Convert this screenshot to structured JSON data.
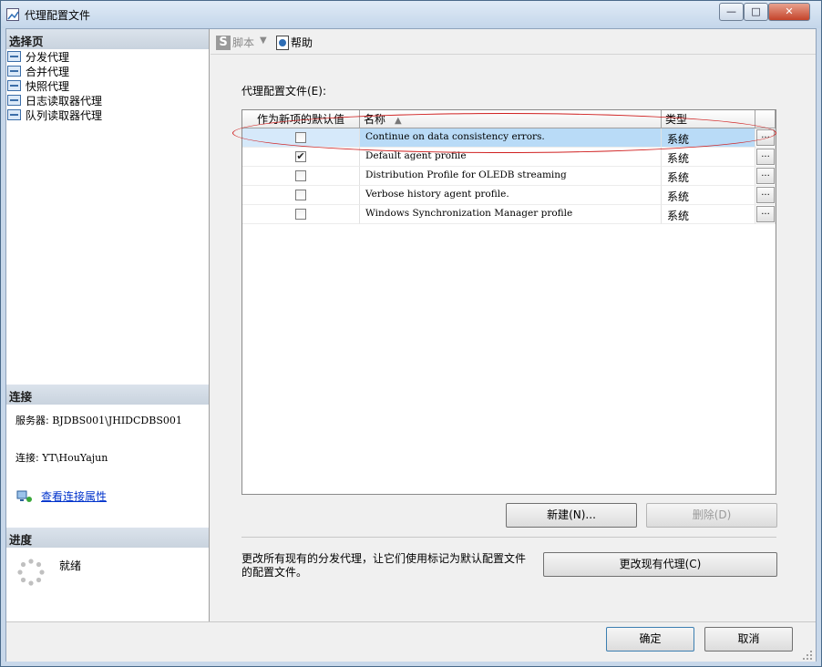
{
  "window": {
    "title": "代理配置文件",
    "controls": {
      "minimize": "—",
      "maximize": "□",
      "close": "✕"
    }
  },
  "sidebar": {
    "select_page_header": "选择页",
    "pages": [
      {
        "label": "分发代理"
      },
      {
        "label": "合并代理"
      },
      {
        "label": "快照代理"
      },
      {
        "label": "日志读取器代理"
      },
      {
        "label": "队列读取器代理"
      }
    ],
    "connection_header": "连接",
    "server_label": "服务器: ",
    "server_value": "BJDBS001\\JHIDCDBS001",
    "connection_label": "连接: ",
    "connection_value": "YT\\HouYajun",
    "view_connection_link": "查看连接属性",
    "progress_header": "进度",
    "progress_status": "就绪"
  },
  "toolbar": {
    "script_label": "脚本",
    "script_dropdown": "▼",
    "help_label": "帮助"
  },
  "main": {
    "profiles_label": "代理配置文件(E):",
    "columns": {
      "default": "作为新项的默认值",
      "name": "名称",
      "type": "类型"
    },
    "sort_indicator": "▲",
    "rows": [
      {
        "checked": false,
        "check_mark": "",
        "name": "Continue on data consistency errors.",
        "type": "系统",
        "dots": "...",
        "selected": true
      },
      {
        "checked": true,
        "check_mark": "✔",
        "name": "Default agent profile",
        "type": "系统",
        "dots": "...",
        "selected": false
      },
      {
        "checked": false,
        "check_mark": "",
        "name": "Distribution Profile for OLEDB streaming",
        "type": "系统",
        "dots": "...",
        "selected": false
      },
      {
        "checked": false,
        "check_mark": "",
        "name": "Verbose history agent profile.",
        "type": "系统",
        "dots": "...",
        "selected": false
      },
      {
        "checked": false,
        "check_mark": "",
        "name": "Windows Synchronization Manager profile",
        "type": "系统",
        "dots": "...",
        "selected": false
      }
    ],
    "new_button": "新建(N)...",
    "delete_button": "删除(D)",
    "change_note": "更改所有现有的分发代理，让它们使用标记为默认配置文件的配置文件。",
    "change_button": "更改现有代理(C)"
  },
  "footer": {
    "ok_button": "确定",
    "cancel_button": "取消"
  },
  "colors": {
    "selected_row": "#b9dbf7",
    "highlight_ellipse": "#d02020",
    "link": "#0033cc"
  }
}
